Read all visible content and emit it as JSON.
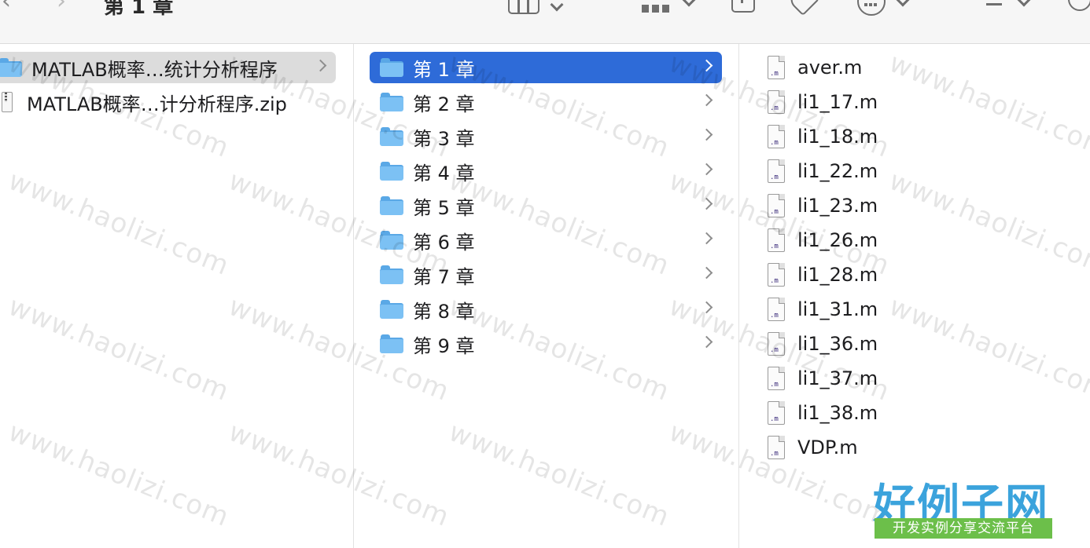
{
  "window": {
    "title": "第 1 章"
  },
  "toolbar": {
    "view_icon": "column-view-icon",
    "group_icon": "group-icon",
    "share_icon": "share-icon",
    "tag_icon": "tag-icon",
    "more_icon": "more-icon",
    "search_icon": "search-icon"
  },
  "column1": {
    "items": [
      {
        "label": "MATLAB概率…统计分析程序",
        "type": "folder",
        "selected": true
      },
      {
        "label": "MATLAB概率…计分析程序.zip",
        "type": "zip"
      }
    ]
  },
  "column2": {
    "items": [
      {
        "label": "第 1 章",
        "selected": true
      },
      {
        "label": "第 2 章"
      },
      {
        "label": "第 3 章"
      },
      {
        "label": "第 4 章"
      },
      {
        "label": "第 5 章"
      },
      {
        "label": "第 6 章"
      },
      {
        "label": "第 7 章"
      },
      {
        "label": "第 8 章"
      },
      {
        "label": "第 9 章"
      }
    ]
  },
  "column3": {
    "file_ext_label": ".m",
    "items": [
      {
        "label": "aver.m"
      },
      {
        "label": "li1_17.m"
      },
      {
        "label": "li1_18.m"
      },
      {
        "label": "li1_22.m"
      },
      {
        "label": "li1_23.m"
      },
      {
        "label": "li1_26.m"
      },
      {
        "label": "li1_28.m"
      },
      {
        "label": "li1_31.m"
      },
      {
        "label": "li1_36.m"
      },
      {
        "label": "li1_37.m"
      },
      {
        "label": "li1_38.m"
      },
      {
        "label": "VDP.m"
      }
    ]
  },
  "watermark": {
    "text": "www.haolizi.com",
    "logo_main": "好例子网",
    "logo_sub": "开发实例分享交流平台"
  },
  "colors": {
    "selection_blue": "#2e6bd8",
    "folder_blue": "#7cc1f4",
    "logo_blue": "#3ba3dc",
    "logo_green": "#6cbf4a"
  }
}
